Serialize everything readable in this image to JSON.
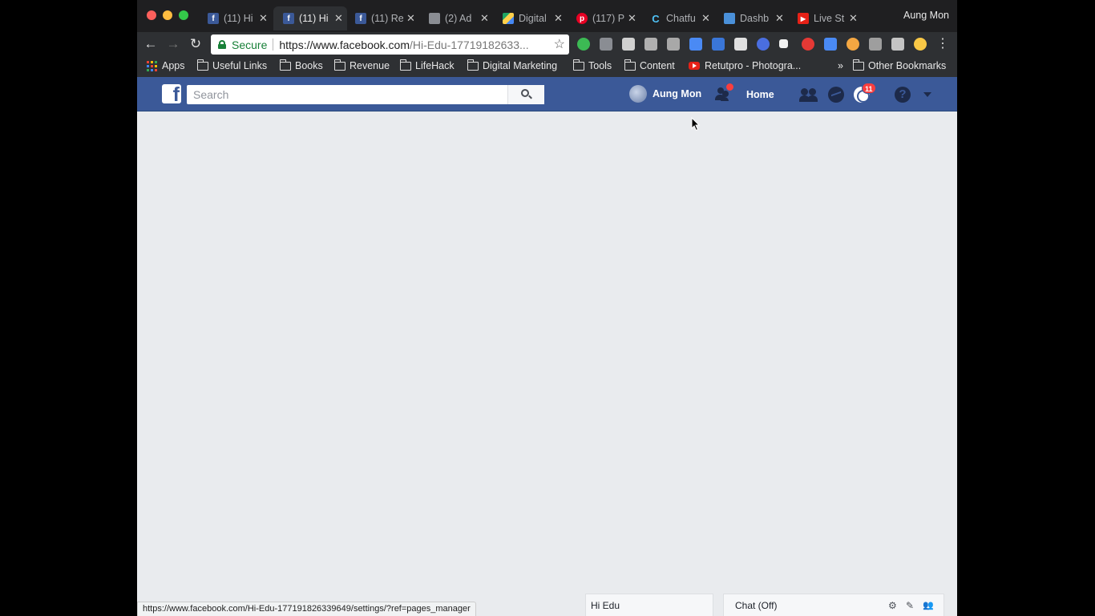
{
  "browser": {
    "tabs": [
      {
        "title": "(11) Hi",
        "favicon": "facebook-icon",
        "active": false
      },
      {
        "title": "(11) Hi",
        "favicon": "facebook-icon",
        "active": true
      },
      {
        "title": "(11) Re",
        "favicon": "facebook-icon",
        "active": false
      },
      {
        "title": "(2) Ad",
        "favicon": "printer-icon",
        "active": false
      },
      {
        "title": "Digital",
        "favicon": "google-drive-icon",
        "active": false
      },
      {
        "title": "(117) P",
        "favicon": "pinterest-icon",
        "active": false
      },
      {
        "title": "Chatfu",
        "favicon": "chatfuel-icon",
        "active": false
      },
      {
        "title": "Dashb",
        "favicon": "dashboard-icon",
        "active": false
      },
      {
        "title": "Live St",
        "favicon": "youtube-icon",
        "active": false
      }
    ],
    "close_glyph": "✕",
    "profile_name": "Aung Mon",
    "omnibox": {
      "secure_label": "Secure",
      "url_main": "https://www.facebook.com",
      "url_path": "/Hi-Edu-17719182633..."
    },
    "bookmarks": {
      "apps": "Apps",
      "items": [
        "Useful Links",
        "Books",
        "Revenue",
        "LifeHack",
        "Digital Marketing",
        "Tools",
        "Content"
      ],
      "youtube_item": "Retutpro - Photogra...",
      "overflow": "»",
      "other": "Other Bookmarks"
    },
    "status_url": "https://www.facebook.com/Hi-Edu-177191826339649/settings/?ref=pages_manager"
  },
  "facebook": {
    "logo_letter": "f",
    "search_placeholder": "Search",
    "user_name": "Aung Mon",
    "home_label": "Home",
    "notifications_count": "11",
    "help_glyph": "?",
    "colors": {
      "bar": "#3b5998",
      "badge": "#fa3e3e",
      "background": "#e9ebee"
    }
  },
  "chat": {
    "page_chat_label": "Hi Edu",
    "chat_label": "Chat (Off)",
    "settings_glyph": "⚙",
    "compose_glyph": "✎",
    "people_glyph": "👥"
  }
}
